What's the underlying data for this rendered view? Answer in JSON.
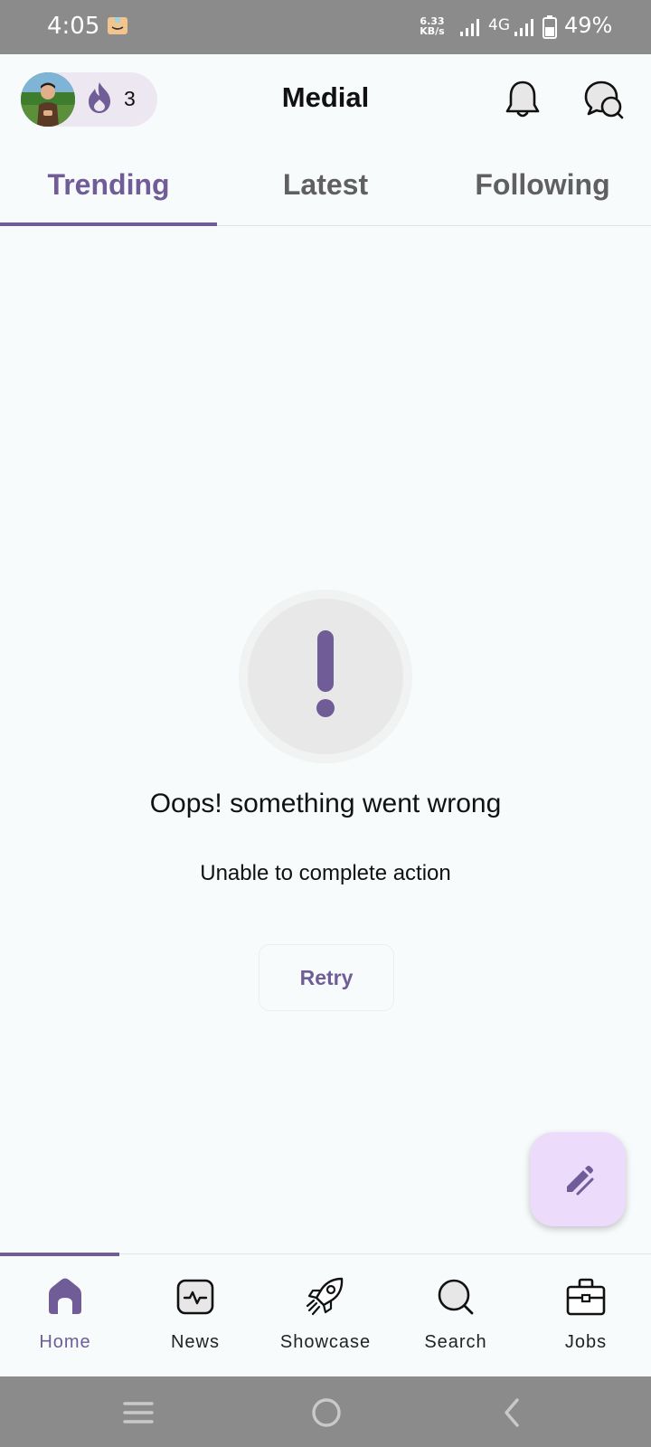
{
  "status_bar": {
    "time": "4:05",
    "net_speed_value": "6.33",
    "net_speed_unit": "KB/s",
    "network_type": "4G",
    "battery": "49%"
  },
  "header": {
    "title": "Medial",
    "streak_count": "3",
    "accent_color": "#705c97"
  },
  "tabs": [
    {
      "label": "Trending",
      "active": true
    },
    {
      "label": "Latest",
      "active": false
    },
    {
      "label": "Following",
      "active": false
    }
  ],
  "error": {
    "title": "Oops! something went wrong",
    "subtitle": "Unable to complete action",
    "retry_label": "Retry",
    "icon": "exclamation-icon"
  },
  "fab": {
    "icon": "edit-icon"
  },
  "bottom_nav": [
    {
      "label": "Home",
      "icon": "home-icon",
      "active": true
    },
    {
      "label": "News",
      "icon": "news-icon",
      "active": false
    },
    {
      "label": "Showcase",
      "icon": "rocket-icon",
      "active": false
    },
    {
      "label": "Search",
      "icon": "search-icon",
      "active": false
    },
    {
      "label": "Jobs",
      "icon": "briefcase-icon",
      "active": false
    }
  ]
}
